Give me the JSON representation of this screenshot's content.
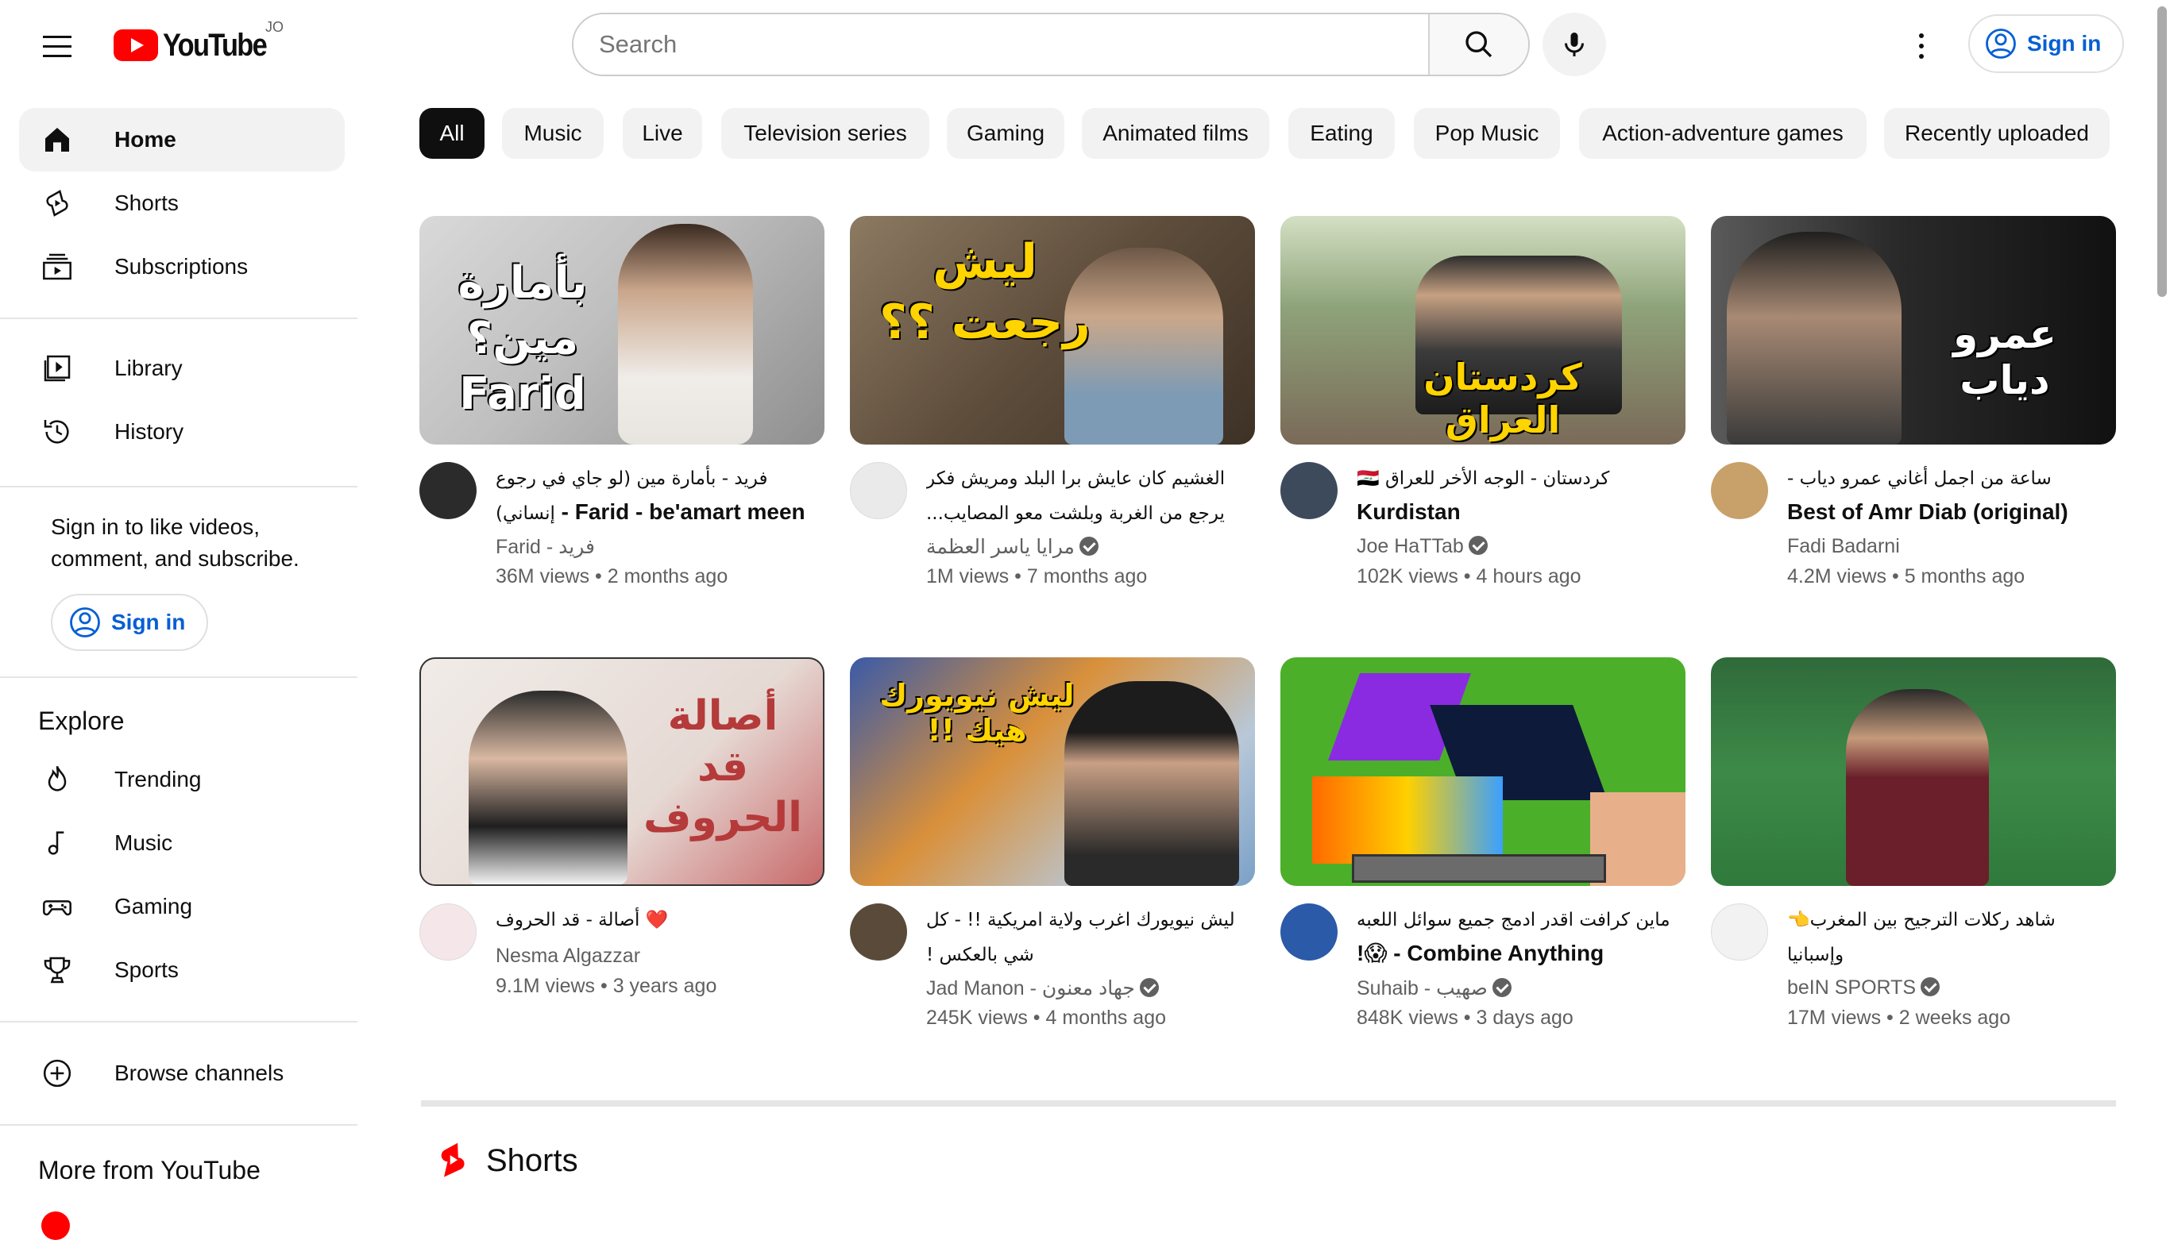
{
  "header": {
    "logo_text": "YouTube",
    "country_code": "JO",
    "search_placeholder": "Search",
    "sign_in": "Sign in"
  },
  "sidebar": {
    "primary": [
      {
        "label": "Home",
        "icon": "home-icon",
        "active": true
      },
      {
        "label": "Shorts",
        "icon": "shorts-icon"
      },
      {
        "label": "Subscriptions",
        "icon": "subscriptions-icon"
      }
    ],
    "secondary": [
      {
        "label": "Library",
        "icon": "library-icon"
      },
      {
        "label": "History",
        "icon": "history-icon"
      }
    ],
    "signin_message": "Sign in to like videos, comment, and subscribe.",
    "signin_button": "Sign in",
    "explore_title": "Explore",
    "explore": [
      {
        "label": "Trending",
        "icon": "trending-icon"
      },
      {
        "label": "Music",
        "icon": "music-icon"
      },
      {
        "label": "Gaming",
        "icon": "gaming-icon"
      },
      {
        "label": "Sports",
        "icon": "sports-icon"
      }
    ],
    "browse_channels": "Browse channels",
    "more_title": "More from YouTube"
  },
  "chips": [
    "All",
    "Music",
    "Live",
    "Television series",
    "Gaming",
    "Animated films",
    "Eating",
    "Pop Music",
    "Action-adventure games",
    "Recently uploaded"
  ],
  "videos": [
    {
      "title_ar": "فريد - بأمارة مين (لو جاي في رجوع إنساني)",
      "title_en": " - Farid - be'amart meen",
      "channel": "Farid - فريد",
      "verified": false,
      "views": "36M views",
      "age": "2 months ago",
      "thumb_text": "بأمارة مين؟ Farid"
    },
    {
      "title_ar": "الغشيم كان عايش برا البلد ومريش فكر يرجع من الغربة وبلشت معو المصايب...",
      "title_en": "",
      "channel": "مرايا ياسر العظمة",
      "verified": true,
      "views": "1M views",
      "age": "7 months ago",
      "thumb_text": "ليش رجعت ؟؟"
    },
    {
      "title_ar": "كردستان - الوجه الأخر للعراق 🇮🇶",
      "title_en": "Kurdistan",
      "channel": "Joe HaTTab",
      "verified": true,
      "views": "102K views",
      "age": "4 hours ago",
      "thumb_text": "كردستان العراق"
    },
    {
      "title_ar": "ساعة من اجمل أغاني عمرو دياب -",
      "title_en": "Best of Amr Diab (original)",
      "channel": "Fadi Badarni",
      "verified": false,
      "views": "4.2M views",
      "age": "5 months ago",
      "thumb_text": "عمرو دياب"
    },
    {
      "title_ar": "❤️ أصالة - قد الحروف",
      "title_en": "",
      "channel": "Nesma Algazzar",
      "verified": false,
      "views": "9.1M views",
      "age": "3 years ago",
      "thumb_text": "أصالة قد الحروف"
    },
    {
      "title_ar": "ليش نيويورك اغرب ولاية امريكية !! - كل شي بالعكس !",
      "title_en": "",
      "channel": "Jad Manon - جهاد معنون",
      "verified": true,
      "views": "245K views",
      "age": "4 months ago",
      "thumb_text": "ليش نيويورك هيك !!"
    },
    {
      "title_ar": "ماين كرافت اقدر ادمج جميع سوائل اللعبه",
      "title_en": "!😱 - Combine Anything",
      "channel": "Suhaib - صهيب",
      "verified": true,
      "views": "848K views",
      "age": "3 days ago",
      "thumb_text": ""
    },
    {
      "title_ar": "شاهد ركلات الترجيح بين المغرب👈 وإسبانيا",
      "title_en": "",
      "channel": "beIN SPORTS",
      "verified": true,
      "views": "17M views",
      "age": "2 weeks ago",
      "thumb_text": ""
    }
  ],
  "shorts_title": "Shorts",
  "colors": {
    "brand_red": "#ff0000",
    "link_blue": "#065fd4",
    "chip_bg": "#f2f2f2"
  }
}
